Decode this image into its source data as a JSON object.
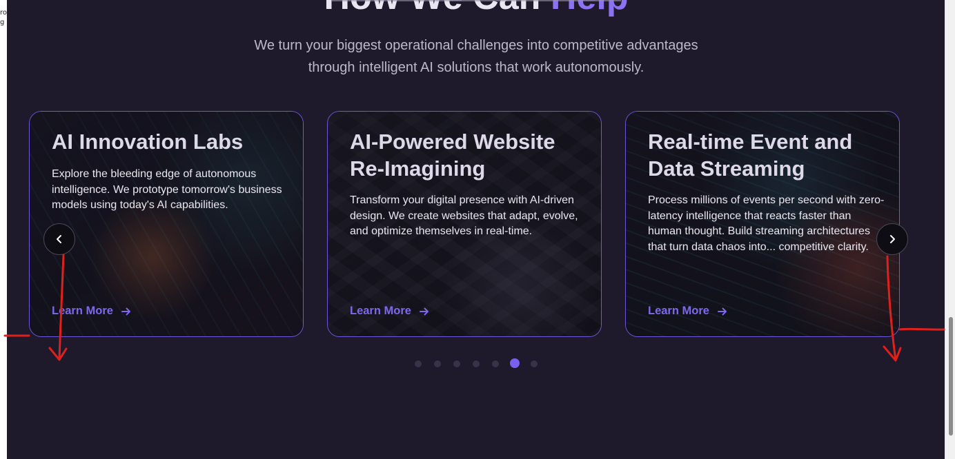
{
  "left_strip": {
    "line1": "ro",
    "line2": "g"
  },
  "section": {
    "heading_main": "How We Can",
    "heading_accent": "Help",
    "subtitle_line1": "We turn your biggest operational challenges into competitive advantages",
    "subtitle_line2": "through intelligent AI solutions that work autonomously."
  },
  "cards": [
    {
      "title": "AI Innovation Labs",
      "text": "Explore the bleeding edge of autonomous intelligence. We prototype tomorrow's business models using today's AI capabilities.",
      "link": "Learn More"
    },
    {
      "title": "AI-Powered Website Re-Imagining",
      "text": "Transform your digital presence with AI-driven design. We create websites that adapt, evolve, and optimize themselves in real-time.",
      "link": "Learn More"
    },
    {
      "title": "Real-time Event and Data Streaming",
      "text": "Process millions of events per second with zero-latency intelligence that reacts faster than human thought. Build streaming architectures that turn data chaos into... competitive clarity.",
      "link": "Learn More"
    }
  ],
  "carousel": {
    "dot_count": 7,
    "active_index": 5
  },
  "icons": {
    "prev": "chevron-left-icon",
    "next": "chevron-right-icon",
    "link_arrow": "arrow-right-icon"
  },
  "colors": {
    "background": "#1e1a2b",
    "accent": "#8b72f0",
    "card_border": "#6f58dc",
    "link": "#7d68ee",
    "annotation": "#e0201a"
  }
}
